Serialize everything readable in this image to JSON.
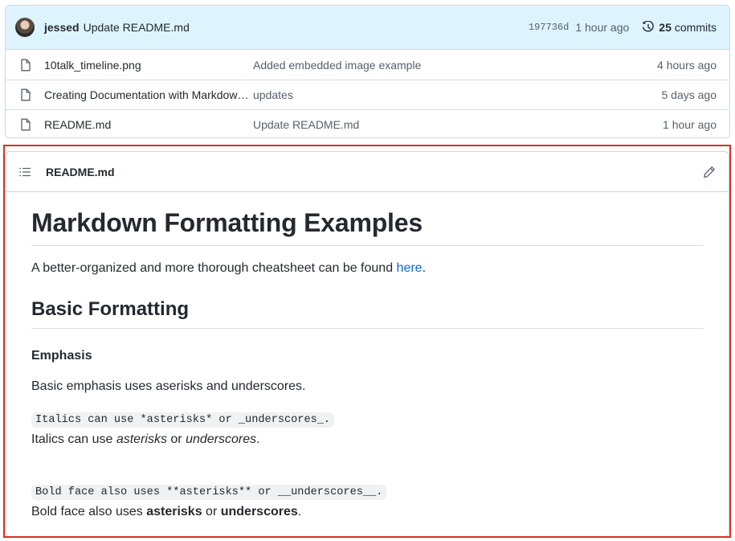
{
  "commit": {
    "author": "jessed",
    "message": "Update README.md",
    "sha": "197736d",
    "time": "1 hour ago",
    "commits_count": "25",
    "commits_label": "commits"
  },
  "files": [
    {
      "name": "10talk_timeline.png",
      "commit": "Added embedded image example",
      "age": "4 hours ago"
    },
    {
      "name": "Creating Documentation with Markdown.md",
      "commit": "updates",
      "age": "5 days ago"
    },
    {
      "name": "README.md",
      "commit": "Update README.md",
      "age": "1 hour ago"
    }
  ],
  "readme": {
    "filename": "README.md",
    "h1": "Markdown Formatting Examples",
    "intro_text": "A better-organized and more thorough cheatsheet can be found ",
    "intro_link": "here",
    "intro_end": ".",
    "h2": "Basic Formatting",
    "h4": "Emphasis",
    "emphasis_desc": "Basic emphasis uses aserisks and underscores.",
    "italics_code": "Italics can use *asterisks* or _underscores_.",
    "italics_pre": "Italics can use ",
    "italics_a": "asterisks",
    "italics_or": " or ",
    "italics_b": "underscores",
    "italics_end": ".",
    "bold_code": "Bold face also uses **asterisks** or __underscores__.",
    "bold_pre": "Bold face also uses ",
    "bold_a": "asterisks",
    "bold_or": " or ",
    "bold_b": "underscores",
    "bold_end": "."
  },
  "colors": {
    "accent_link": "#0969da",
    "commit_bar_bg": "#ddf4ff",
    "highlight_border": "#d93025"
  }
}
